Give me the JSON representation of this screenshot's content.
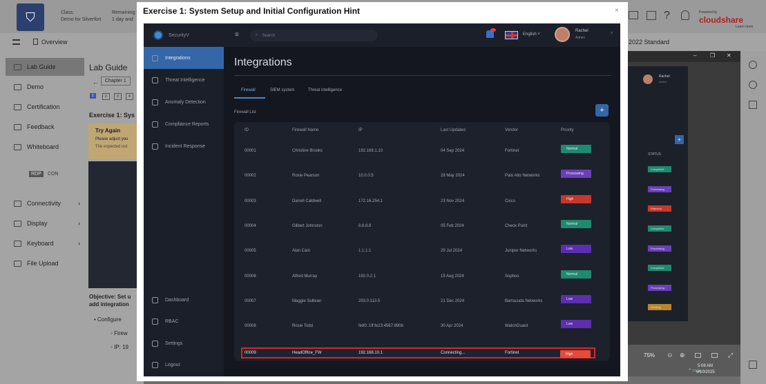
{
  "background": {
    "class_label": "Class:",
    "class_value": "Demo for Silverfort",
    "remaining_label": "Remaining",
    "remaining_value": "1 day and",
    "overview": "Overview",
    "standard": "2022 Standard",
    "powered_by": "Powered by",
    "brand": "cloudshare",
    "brand_sub": "Learn more",
    "sidebar": [
      "Lab Guide",
      "Demo",
      "Certification",
      "Feedback",
      "Whiteboard"
    ],
    "sidebar_bottom": [
      "Connectivity",
      "Display",
      "Keyboard",
      "File Upload"
    ],
    "rdp": "RDP",
    "con": "CON",
    "lab_guide_title": "Lab Guide",
    "chapter": "Chapter 1",
    "steps": [
      "1",
      "2",
      "3",
      "4"
    ],
    "exercise_peek": "Exercise 1: Sys",
    "try_again": "Try Again",
    "try_line1": "Please adjust you",
    "try_line2": "The expected out",
    "objective": "Objective: Set u",
    "objective2": "add integration",
    "bullet1": "Configure",
    "bullet2": "Firew",
    "bullet3": "IP: 19",
    "right_user": "Rachel",
    "right_role": "Admin",
    "right_status_header": "STATUS",
    "right_statuses": [
      "Completed",
      "Processing",
      "Rejected",
      "Completed",
      "Processing",
      "Completed",
      "Processing",
      "Pending"
    ],
    "zoom": "75%",
    "clock_time": "5:08 AM",
    "clock_date": "6/10/2025"
  },
  "modal": {
    "title": "Exercise 1: System Setup and Initial Configuration Hint",
    "close": "×"
  },
  "app": {
    "brand": "SecurityV",
    "nav": [
      "Integrations",
      "Threat Intelligence",
      "Anomaly Detection",
      "Compliance Reports",
      "Incident Response"
    ],
    "nav_bottom": [
      "Dashboard",
      "RBAC",
      "Settings",
      "Logout"
    ],
    "search_placeholder": "Search",
    "language": "English",
    "user_name": "Rachel",
    "user_role": "Admin",
    "page_title": "Integrations",
    "tabs": [
      "Firewall",
      "SIEM system",
      "Threat intelligence"
    ],
    "list_title": "Firewall List",
    "add_label": "+",
    "columns": [
      "ID",
      "Firewall Name",
      "IP",
      "Last Updated",
      "Vendor",
      "Priority"
    ],
    "rows": [
      {
        "id": "00001",
        "name": "Christine Brooks",
        "ip": "192.168.1.10",
        "updated": "04 Sep 2024",
        "vendor": "Fortinet",
        "priority": "Normal",
        "color": "#1e8a6f"
      },
      {
        "id": "00002",
        "name": "Rosie Pearson",
        "ip": "10.0.0.5",
        "updated": "28 May 2024",
        "vendor": "Palo Alto Networks",
        "priority": "Processing",
        "color": "#6a3fb8"
      },
      {
        "id": "00003",
        "name": "Darrell Caldwell",
        "ip": "172.16.254.1",
        "updated": "23 Nov 2024",
        "vendor": "Cisco",
        "priority": "High",
        "color": "#c7382c"
      },
      {
        "id": "00004",
        "name": "Gilbert Johnston",
        "ip": "8.8.8.8",
        "updated": "05 Feb 2024",
        "vendor": "Check Point",
        "priority": "Normal",
        "color": "#1e8a6f"
      },
      {
        "id": "00005",
        "name": "Alan Cain",
        "ip": "1.1.1.1",
        "updated": "29 Jul 2024",
        "vendor": "Juniper Networks",
        "priority": "Low",
        "color": "#5b2fb0"
      },
      {
        "id": "00006",
        "name": "Alfred Murray",
        "ip": "192.0.2.1",
        "updated": "15 Aug 2024",
        "vendor": "Sophos",
        "priority": "Normal",
        "color": "#1e8a6f"
      },
      {
        "id": "00007",
        "name": "Maggie Sullivan",
        "ip": "203.0.113.5",
        "updated": "21 Dec 2024",
        "vendor": "Barracuda Networks",
        "priority": "Low",
        "color": "#5b2fb0"
      },
      {
        "id": "00008",
        "name": "Rosie Todd",
        "ip": "fe80::1ff:fe23:4567:890b",
        "updated": "30 Apr 2024",
        "vendor": "WatchGuard",
        "priority": "Low",
        "color": "#5b2fb0"
      }
    ],
    "highlight_row": {
      "id": "00009",
      "name": "HeadOffice_FW",
      "ip": "192.168.10.1",
      "updated": "Connecting...",
      "vendor": "Fortinet",
      "priority": "High"
    }
  }
}
